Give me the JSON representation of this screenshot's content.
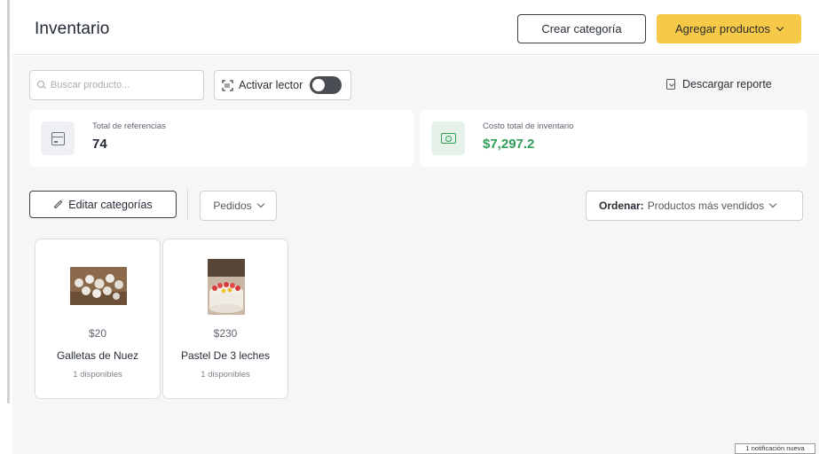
{
  "header": {
    "title": "Inventario",
    "create_category_label": "Crear categoría",
    "add_products_label": "Agregar productos"
  },
  "toolbar": {
    "search_placeholder": "Buscar producto...",
    "reader_label": "Activar lector",
    "reader_enabled": false,
    "download_label": "Descargar reporte"
  },
  "stats": [
    {
      "label": "Total de referencias",
      "value": "74",
      "icon": "box-icon"
    },
    {
      "label": "Costo total de inventario",
      "value": "$7,297.2",
      "icon": "money-icon",
      "value_color": "#2f9e56"
    }
  ],
  "actions": {
    "edit_categories_label": "Editar categorías",
    "orders_label": "Pedidos",
    "sort_prefix": "Ordenar:",
    "sort_value": "Productos más vendidos"
  },
  "products": [
    {
      "price": "$20",
      "name": "Galletas de Nuez",
      "stock": "1 disponibles"
    },
    {
      "price": "$230",
      "name": "Pastel De 3 leches",
      "stock": "1 disponibles"
    }
  ],
  "notification": {
    "text": "1 notificación nueva"
  },
  "colors": {
    "accent": "#f7c948",
    "success": "#2f9e56"
  }
}
